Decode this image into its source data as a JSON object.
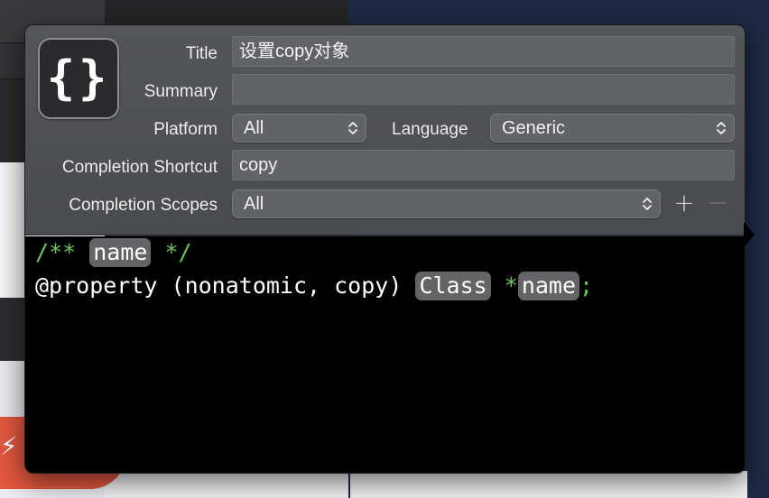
{
  "form": {
    "title_label": "Title",
    "title_value": "设置copy对象",
    "summary_label": "Summary",
    "summary_value": "",
    "platform_label": "Platform",
    "platform_value": "All",
    "language_label": "Language",
    "language_value": "Generic",
    "shortcut_label": "Completion Shortcut",
    "shortcut_value": "copy",
    "scopes_label": "Completion Scopes",
    "scopes_value": "All",
    "add_scope": "+",
    "remove_scope": "−"
  },
  "icon": {
    "snippet": "snippet-braces-icon",
    "glyph": "{}"
  },
  "code": {
    "line1": {
      "open": "/** ",
      "placeholder": "name",
      "close": " */"
    },
    "line2": {
      "text": "@property (nonatomic, copy) ",
      "class_placeholder": "Class",
      "star": " *",
      "name_placeholder": "name",
      "semicolon": ";"
    }
  },
  "colors": {
    "comment": "#6cc45b",
    "token_bg": "#646466",
    "form_bg": "#505155",
    "editor_bg": "#000000"
  }
}
